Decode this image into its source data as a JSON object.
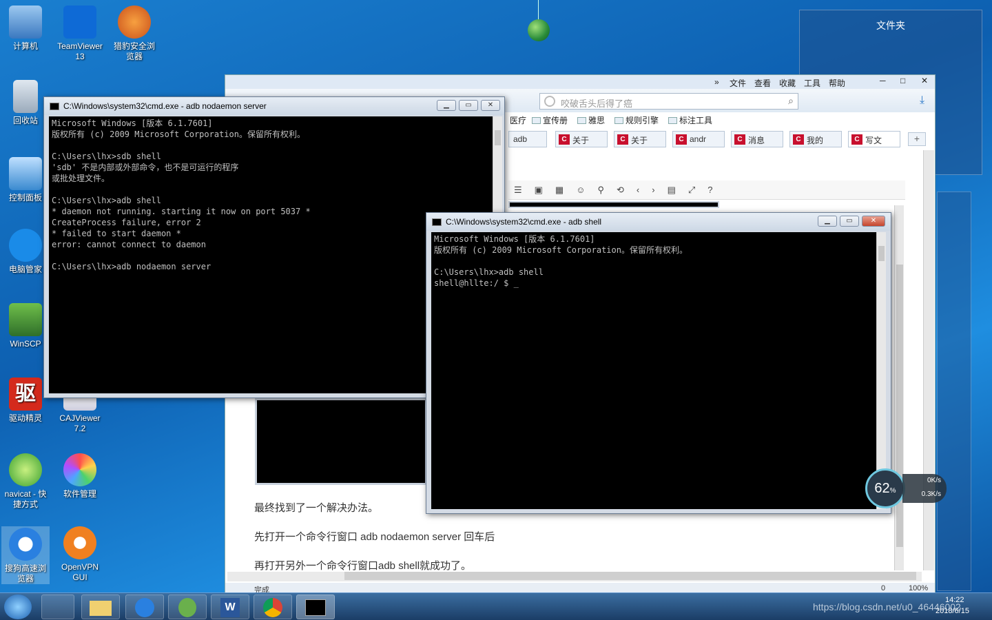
{
  "desktop": {
    "icons": [
      {
        "label": "计算机"
      },
      {
        "label": "TeamViewer 13"
      },
      {
        "label": "猎豹安全浏览器"
      },
      {
        "label": "回收站"
      },
      {
        "label": "控制面板"
      },
      {
        "label": "电脑管家"
      },
      {
        "label": "WinSCP"
      },
      {
        "label": "驱动精灵"
      },
      {
        "label": "CAJViewer 7.2"
      },
      {
        "label": "navicat - 快捷方式"
      },
      {
        "label": "软件管理"
      },
      {
        "label": "搜狗高速浏览器"
      },
      {
        "label": "OpenVPN GUI"
      }
    ]
  },
  "folder_widget": {
    "title": "文件夹"
  },
  "browser": {
    "menu": [
      "»",
      "文件",
      "查看",
      "收藏",
      "工具",
      "帮助"
    ],
    "search_placeholder": "咬破舌头后得了癌",
    "bookmarks": [
      "医疗",
      "宣传册",
      "雅思",
      "规则引擎",
      "标注工具"
    ],
    "tabs": [
      "adb",
      "关于",
      "关于",
      "andr",
      "消息",
      "我的",
      "写文"
    ],
    "article": [
      "最终找到了一个解决办法。",
      "先打开一个命令行窗口 adb nodaemon server 回车后",
      "再打开另外一个命令行窗口adb shell就成功了。"
    ],
    "status": {
      "left": "完成",
      "zoom": "100%",
      "count": "0"
    }
  },
  "cmd1": {
    "title": "C:\\Windows\\system32\\cmd.exe - adb  nodaemon server",
    "lines": "Microsoft Windows [版本 6.1.7601]\n版权所有 (c) 2009 Microsoft Corporation。保留所有权利。\n\nC:\\Users\\lhx>sdb shell\n'sdb' 不是内部或外部命令，也不是可运行的程序\n或批处理文件。\n\nC:\\Users\\lhx>adb shell\n* daemon not running. starting it now on port 5037 *\nCreateProcess failure, error 2\n* failed to start daemon *\nerror: cannot connect to daemon\n\nC:\\Users\\lhx>adb nodaemon server"
  },
  "cmd2": {
    "title": "C:\\Windows\\system32\\cmd.exe - adb  shell",
    "lines": "Microsoft Windows [版本 6.1.7601]\n版权所有 (c) 2009 Microsoft Corporation。保留所有权利。\n\nC:\\Users\\lhx>adb shell\nshell@hllte:/ $ _"
  },
  "net_widget": {
    "percent": "62",
    "unit": "%",
    "up": "0K/s",
    "down": "0.3K/s"
  },
  "taskbar": {
    "time": "14:22",
    "date": "2018/6/15",
    "watermark": "https://blog.csdn.net/u0_46446002"
  }
}
